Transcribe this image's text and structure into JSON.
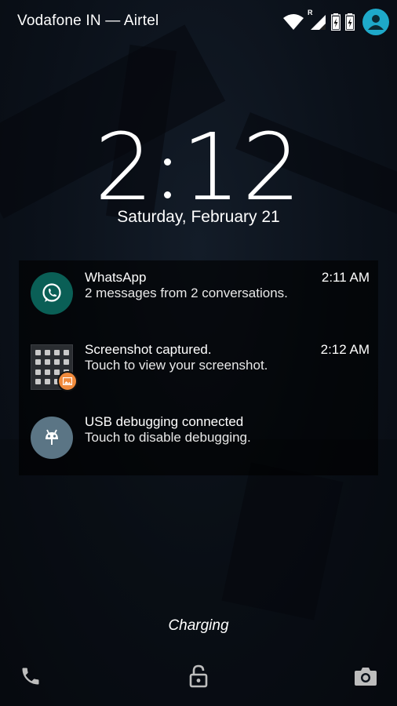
{
  "status_bar": {
    "carrier": "Vodafone IN — Airtel",
    "roaming_indicator": "R",
    "icons": [
      "wifi-icon",
      "signal-icon",
      "battery-charging-icon",
      "battery-charging-icon",
      "user-avatar-icon"
    ]
  },
  "lockscreen": {
    "clock_hour": "2",
    "clock_minute": "12",
    "date": "Saturday, February 21"
  },
  "notifications": [
    {
      "app": "whatsapp",
      "title": "WhatsApp",
      "text": "2 messages from 2 conversations.",
      "time": "2:11 AM",
      "icon": "whatsapp-icon",
      "icon_color": "#0a5f56"
    },
    {
      "app": "screenshot",
      "title": "Screenshot captured.",
      "text": "Touch to view your screenshot.",
      "time": "2:12 AM",
      "icon": "screenshot-thumbnail",
      "badge_color": "#f08a3c"
    },
    {
      "app": "usb-debugging",
      "title": "USB debugging connected",
      "text": "Touch to disable debugging.",
      "time": "",
      "icon": "android-debug-icon",
      "icon_color": "#5b7585"
    }
  ],
  "footer": {
    "charging_label": "Charging",
    "left_icon": "phone-icon",
    "center_icon": "lock-icon",
    "right_icon": "camera-icon"
  },
  "colors": {
    "avatar": "#1ea9c9",
    "background": "#0b111a"
  }
}
